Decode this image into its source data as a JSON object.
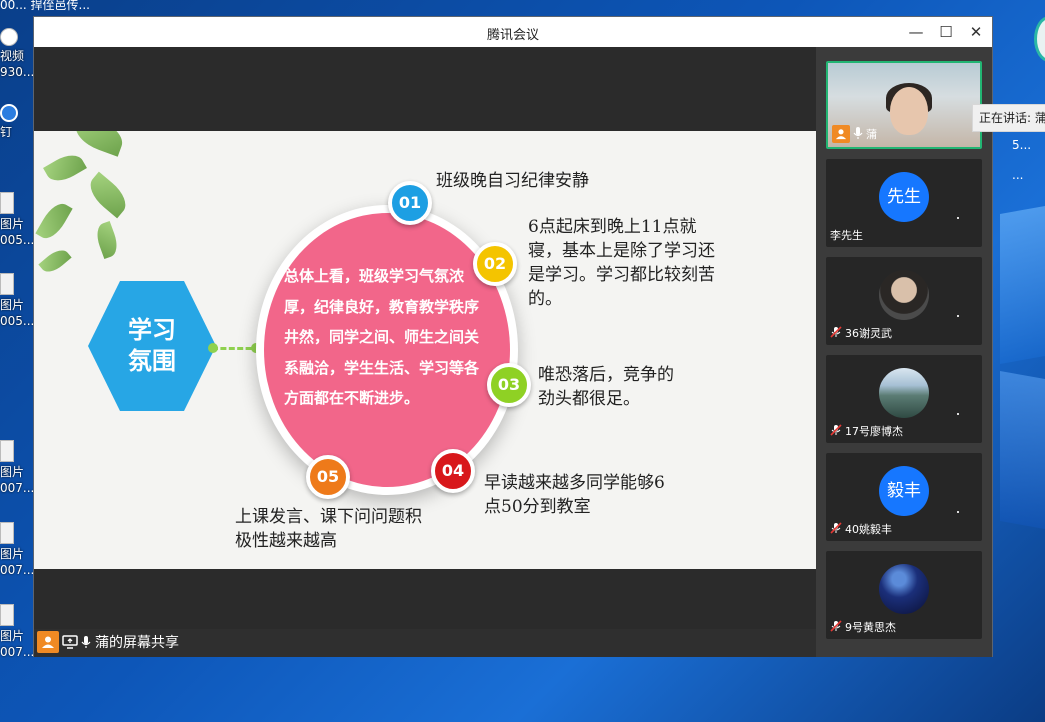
{
  "desktop": {
    "top_fragment": "00...   捍侄邑传...",
    "icons": [
      {
        "lines": [
          "视频",
          "930..."
        ]
      },
      {
        "lines": [
          "钉"
        ]
      },
      {
        "lines": [
          "图片",
          "005..."
        ]
      },
      {
        "lines": [
          "图片",
          "005..."
        ]
      },
      {
        "lines": [
          "图片",
          "007..."
        ]
      },
      {
        "lines": [
          "图片",
          "007..."
        ]
      },
      {
        "lines": [
          "图片",
          "007..."
        ]
      }
    ],
    "right_fragments": [
      "5...",
      "..."
    ]
  },
  "window": {
    "title": "腾讯会议",
    "minimize_glyph": "—",
    "maximize_glyph": "☐",
    "close_glyph": "✕"
  },
  "slide": {
    "hexagon_text": "学习\n氛围",
    "center_text": "总体上看，班级学习气氛浓厚，纪律良好，教育教学秩序井然，同学之间、师生之间关系融洽，学生生活、学习等各方面都在不断进步。",
    "items": [
      {
        "num": "01",
        "text": "班级晚自习纪律安静"
      },
      {
        "num": "02",
        "text": "6点起床到晚上11点就寝，基本上是除了学习还是学习。学习都比较刻苦的。"
      },
      {
        "num": "03",
        "text": "唯恐落后，竞争的劲头都很足。"
      },
      {
        "num": "04",
        "text": "早读越来越多同学能够6点50分到教室"
      },
      {
        "num": "05",
        "text": "上课发言、课下问问题积极性越来越高"
      }
    ]
  },
  "share": {
    "label": "蒲的屏幕共享"
  },
  "participants": [
    {
      "name": "蒲",
      "kind": "camera",
      "active": true,
      "mic": "on"
    },
    {
      "name": "李先生",
      "kind": "text-avatar",
      "avatar_text": "先生",
      "mic": "none"
    },
    {
      "name": "36谢灵武",
      "kind": "photo",
      "photo": "boy",
      "mic": "muted"
    },
    {
      "name": "17号廖博杰",
      "kind": "photo",
      "photo": "lake",
      "mic": "muted"
    },
    {
      "name": "40姚毅丰",
      "kind": "text-avatar",
      "avatar_text": "毅丰",
      "mic": "muted"
    },
    {
      "name": "9号黄思杰",
      "kind": "photo",
      "photo": "star",
      "mic": "muted"
    }
  ],
  "tooltip": "正在讲话: 蒲",
  "colors": {
    "accent_green": "#22b573",
    "avatar_blue": "#1677ff",
    "badge_01": "#1d9fe3",
    "badge_02": "#f4c400",
    "badge_03": "#8fd124",
    "badge_04": "#d8181b",
    "badge_05": "#ee7a1a",
    "center_pink": "#f2668a",
    "hexagon_blue": "#27a6e5"
  }
}
